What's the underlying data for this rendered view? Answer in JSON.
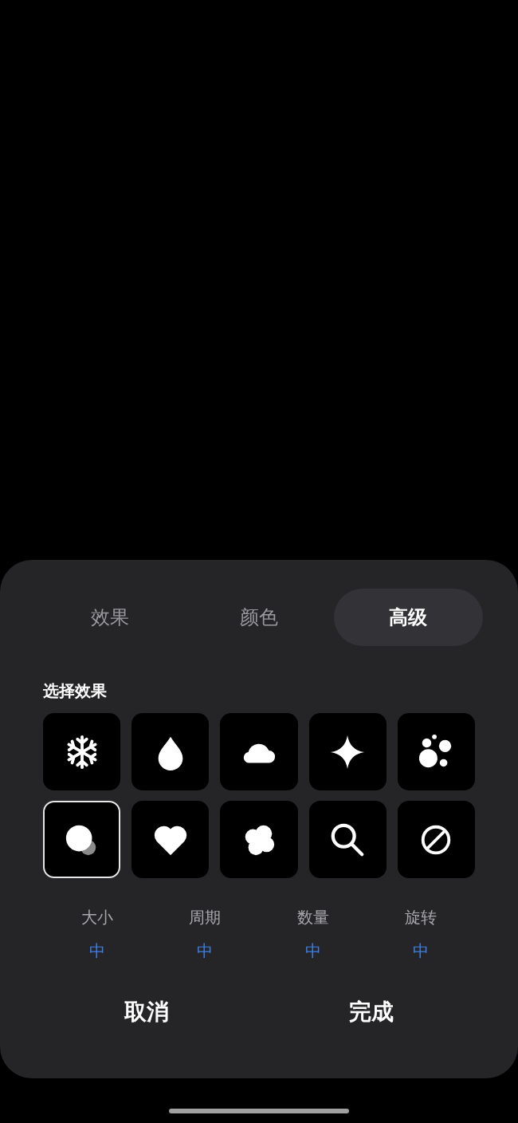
{
  "tabs": [
    {
      "label": "效果",
      "selected": false
    },
    {
      "label": "颜色",
      "selected": false
    },
    {
      "label": "高级",
      "selected": true
    }
  ],
  "section_title": "选择效果",
  "effects": [
    {
      "kind": "snowflake",
      "selected": false
    },
    {
      "kind": "drop",
      "selected": false
    },
    {
      "kind": "cloud",
      "selected": false
    },
    {
      "kind": "sparkle",
      "selected": false
    },
    {
      "kind": "bubbles",
      "selected": false
    },
    {
      "kind": "circles",
      "selected": true
    },
    {
      "kind": "heart",
      "selected": false
    },
    {
      "kind": "blob",
      "selected": false
    },
    {
      "kind": "magnifier",
      "selected": false
    },
    {
      "kind": "none",
      "selected": false
    }
  ],
  "settings": [
    {
      "label": "大小",
      "value": "中"
    },
    {
      "label": "周期",
      "value": "中"
    },
    {
      "label": "数量",
      "value": "中"
    },
    {
      "label": "旋转",
      "value": "中"
    }
  ],
  "buttons": [
    {
      "label": "取消"
    },
    {
      "label": "完成"
    }
  ]
}
